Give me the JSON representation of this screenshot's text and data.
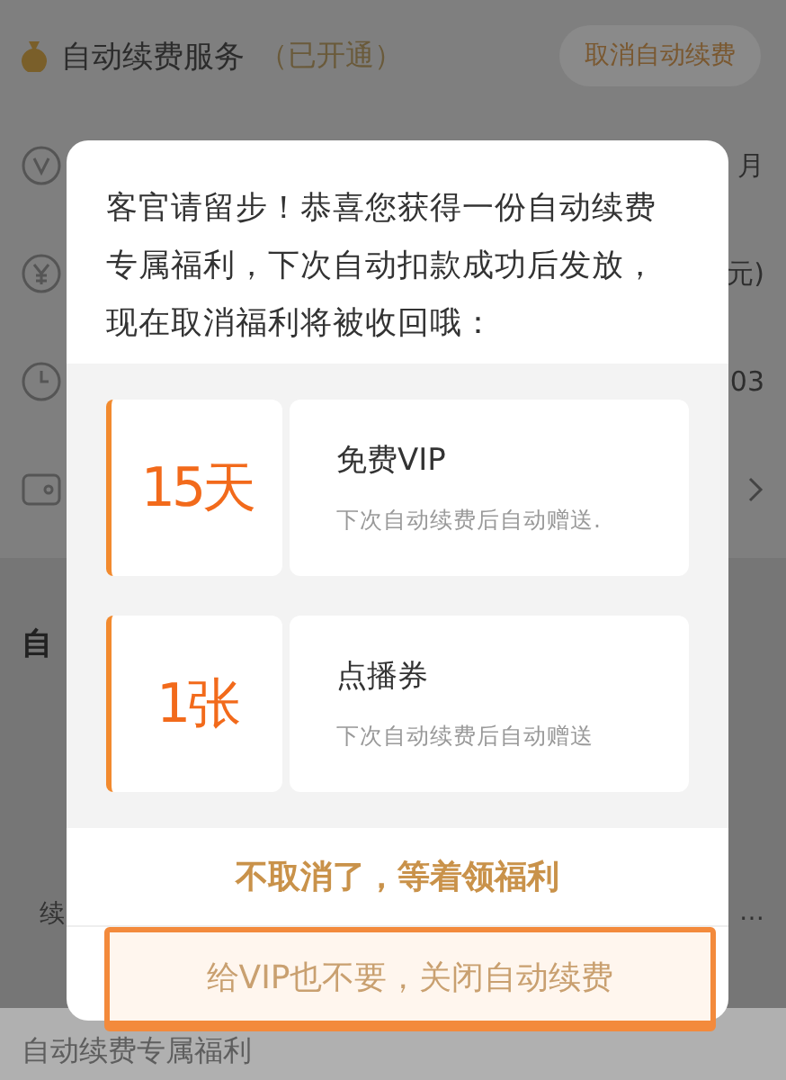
{
  "header": {
    "title": "自动续费服务",
    "status": "（已开通）",
    "cancel_button": "取消自动续费"
  },
  "rows": [
    {
      "kind": "vip",
      "value": "月"
    },
    {
      "kind": "price",
      "value": "元)"
    },
    {
      "kind": "clock",
      "value": "03"
    },
    {
      "kind": "card",
      "value": ""
    }
  ],
  "section": {
    "title": "自",
    "row_label": "续",
    "row_more": "…"
  },
  "footer": {
    "title": "自动续费专属福利"
  },
  "dialog": {
    "message": "客官请留步！恭喜您获得一份自动续费专属福利，下次自动扣款成功后发放，现在取消福利将被收回哦：",
    "benefits": [
      {
        "amount": "15天",
        "title": "免费VIP",
        "note": "下次自动续费后自动赠送."
      },
      {
        "amount": "1张",
        "title": "点播券",
        "note": "下次自动续费后自动赠送"
      }
    ],
    "keep_button": "不取消了，等着领福利",
    "close_button": "给VIP也不要，关闭自动续费",
    "close_highlighted": true
  }
}
